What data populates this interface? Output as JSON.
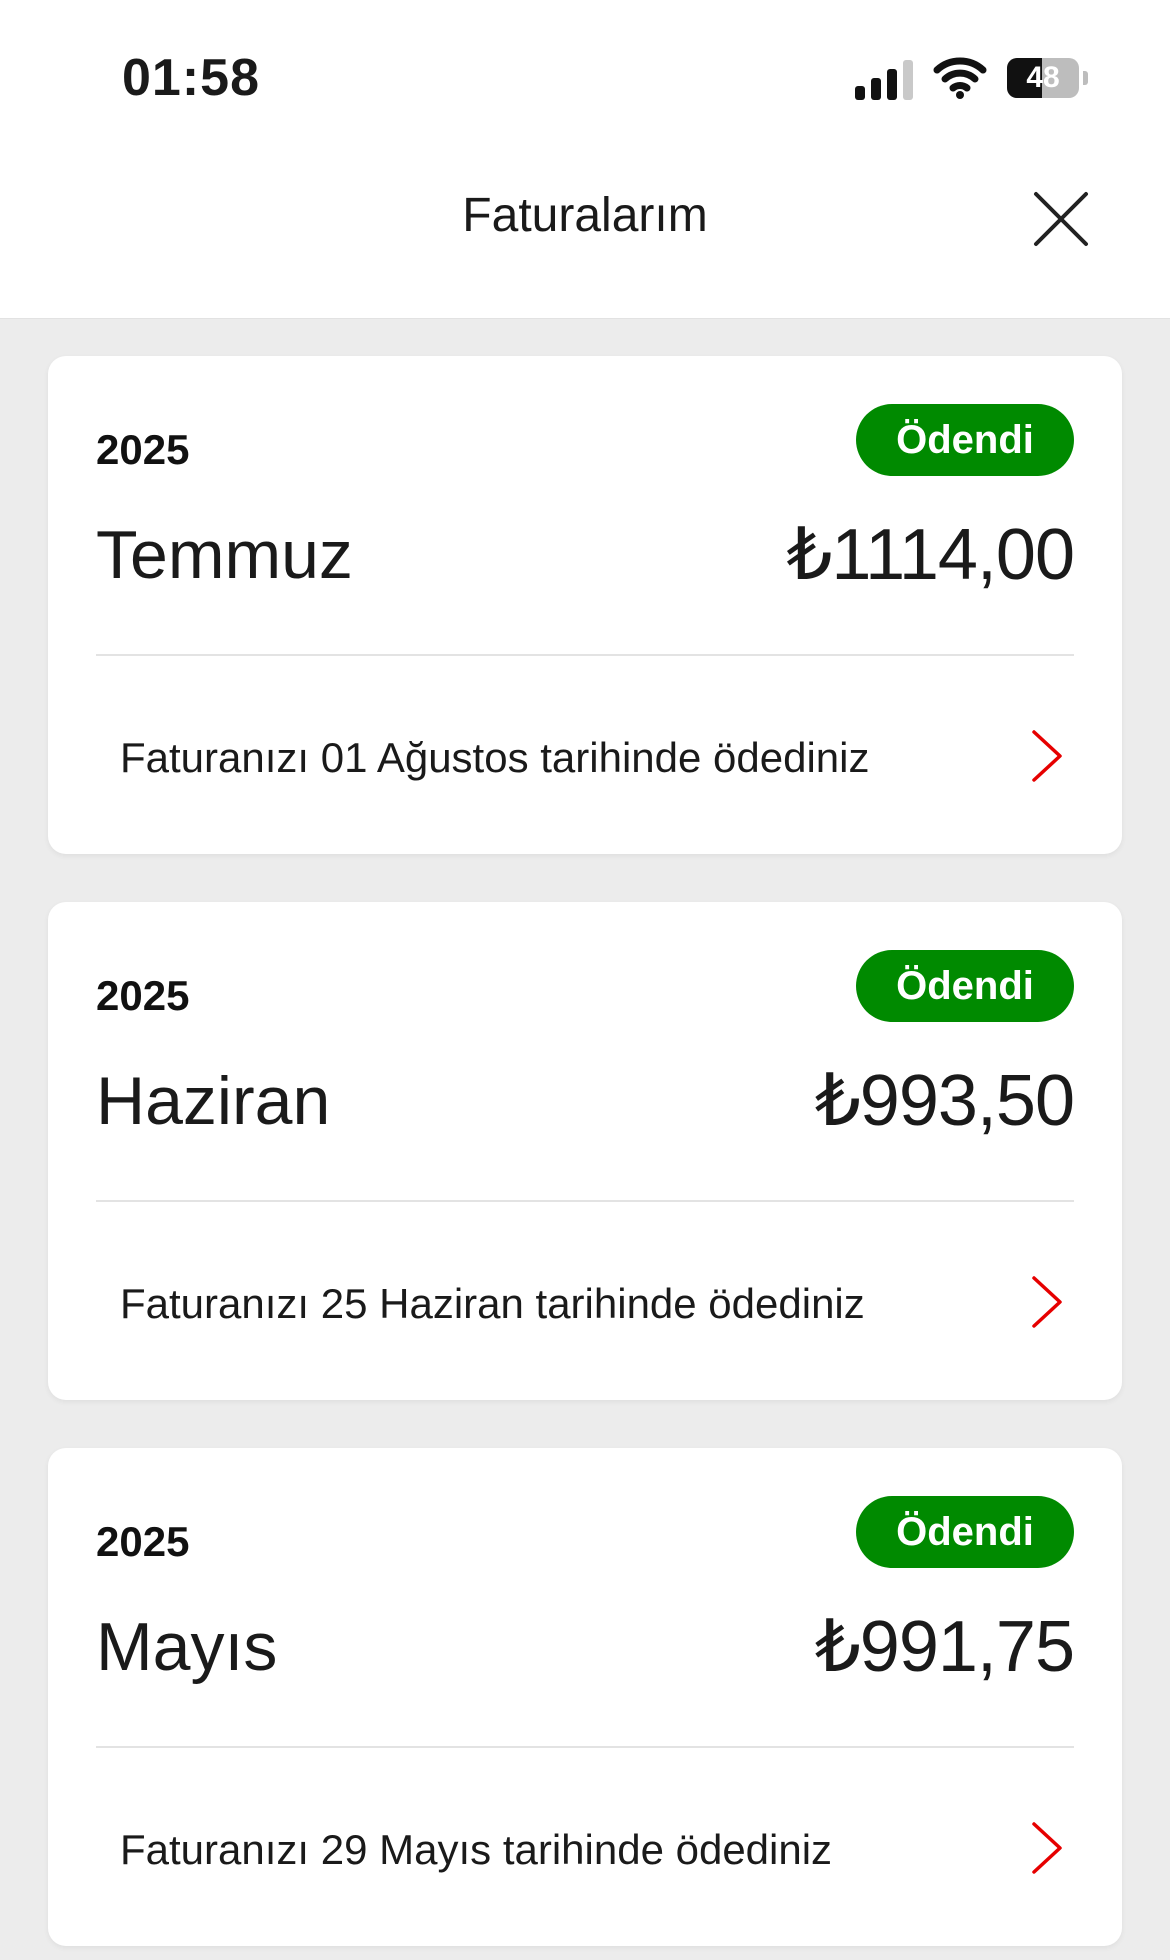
{
  "status_bar": {
    "time": "01:58",
    "battery": "48",
    "battery_level": 0.48,
    "signal_bars": 3,
    "signal_total": 4
  },
  "header": {
    "title": "Faturalarım",
    "close_icon": "close-icon"
  },
  "colors": {
    "badge": "#008a00",
    "chevron": "#e60000",
    "background": "#ececec"
  },
  "bills": [
    {
      "year": "2025",
      "status": "Ödendi",
      "month": "Temmuz",
      "amount": "₺1114,00",
      "note": "Faturanızı 01 Ağustos tarihinde ödediniz"
    },
    {
      "year": "2025",
      "status": "Ödendi",
      "month": "Haziran",
      "amount": "₺993,50",
      "note": "Faturanızı 25 Haziran tarihinde ödediniz"
    },
    {
      "year": "2025",
      "status": "Ödendi",
      "month": "Mayıs",
      "amount": "₺991,75",
      "note": "Faturanızı 29 Mayıs tarihinde ödediniz"
    }
  ]
}
